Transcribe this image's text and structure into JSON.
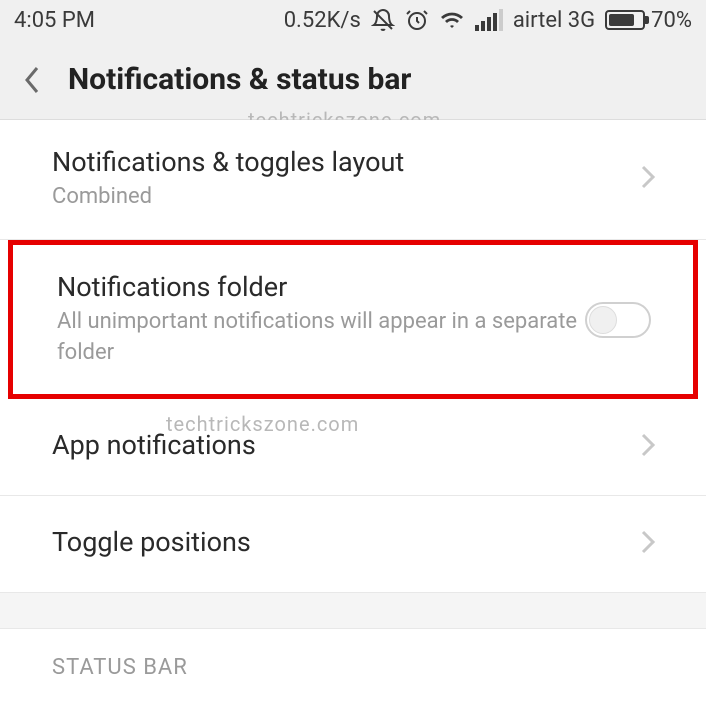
{
  "statusbar": {
    "time": "4:05 PM",
    "speed": "0.52K/s",
    "carrier": "airtel 3G",
    "battery_pct": "70%"
  },
  "header": {
    "title": "Notifications & status bar"
  },
  "watermarks": {
    "w1": "techtrickszone.com",
    "w2": "techtrickszone.com"
  },
  "rows": {
    "layout": {
      "title": "Notifications & toggles layout",
      "subtitle": "Combined"
    },
    "folder": {
      "title": "Notifications folder",
      "subtitle": "All unimportant notifications will appear in a separate folder",
      "toggle_on": false
    },
    "app": {
      "title": "App notifications"
    },
    "toggle_pos": {
      "title": "Toggle positions"
    }
  },
  "section": {
    "statusbar_header": "STATUS BAR"
  }
}
